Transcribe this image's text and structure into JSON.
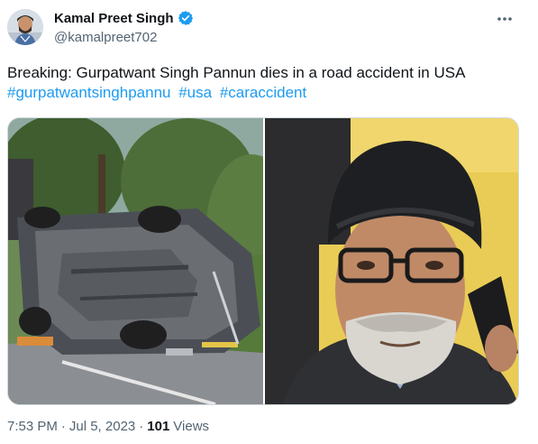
{
  "author": {
    "display_name": "Kamal Preet Singh",
    "handle": "@kamalpreet702",
    "verified_icon": "verified-badge-icon"
  },
  "tweet": {
    "text": "Breaking: Gurpatwant Singh Pannun dies in a road accident in USA",
    "hashtags": [
      "#gurpatwantsinghpannu",
      "#usa",
      "#caraccident"
    ]
  },
  "meta": {
    "time": "7:53 PM",
    "separator": "·",
    "date": "Jul 5, 2023",
    "views_count": "101",
    "views_label": "Views"
  },
  "colors": {
    "accent": "#1d9bf0",
    "text": "#0f1419",
    "muted": "#536471",
    "border": "#cfd9de"
  },
  "icons": {
    "more": "more-options-icon"
  }
}
